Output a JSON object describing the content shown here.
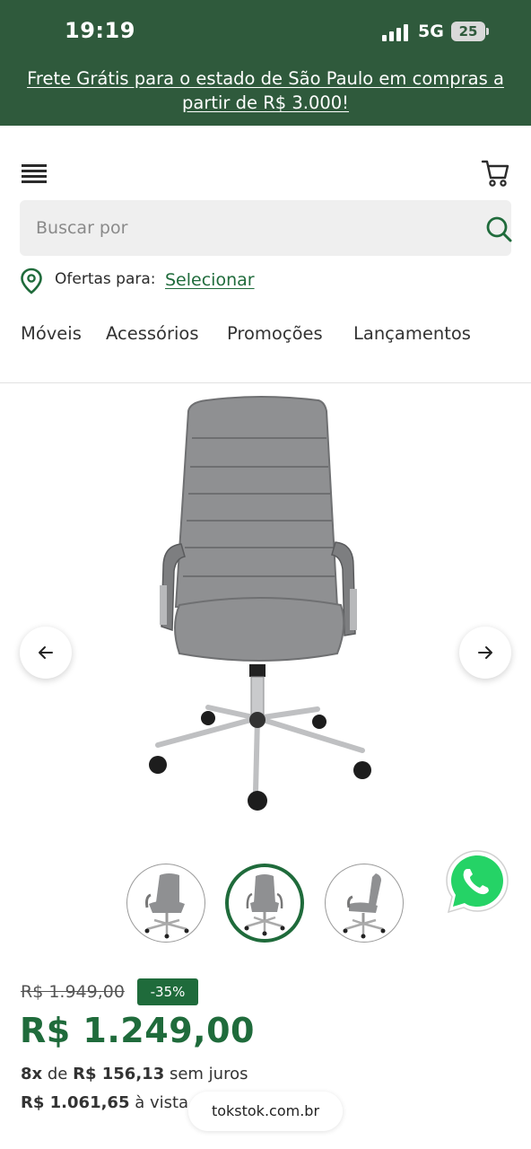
{
  "status_bar": {
    "time": "19:19",
    "network": "5G",
    "battery": "25"
  },
  "promo_banner": {
    "text": "Frete Grátis para o estado de São Paulo em compras a partir de R$ 3.000!",
    "background_color": "#2f5a3c"
  },
  "header": {
    "menu_icon": "hamburger-menu-icon",
    "cart_icon": "shopping-cart-icon"
  },
  "search": {
    "placeholder": "Buscar por",
    "icon": "search-icon"
  },
  "location": {
    "label": "Ofertas para:",
    "link": "Selecionar",
    "icon": "map-pin-icon"
  },
  "categories": [
    {
      "label": "Móveis"
    },
    {
      "label": "Acessórios"
    },
    {
      "label": "Promoções"
    },
    {
      "label": "Lançamentos"
    }
  ],
  "gallery": {
    "prev_icon": "arrow-left-icon",
    "next_icon": "arrow-right-icon",
    "thumbnails": [
      {
        "name": "chair-angled-view",
        "active": false
      },
      {
        "name": "chair-front-view",
        "active": true
      },
      {
        "name": "chair-side-view",
        "active": false
      }
    ]
  },
  "whatsapp": {
    "icon": "whatsapp-icon",
    "color": "#25d366"
  },
  "pricing": {
    "old_price": "R$ 1.949,00",
    "discount": "-35%",
    "price": "R$ 1.249,00",
    "installments_count": "8x",
    "installments_of": "de",
    "installments_value": "R$ 156,13",
    "installments_suffix": "sem juros",
    "cash_value": "R$ 1.061,65",
    "cash_suffix": "à vista"
  },
  "browser": {
    "url": "tokstok.com.br"
  },
  "theme": {
    "accent": "#1f6b3b"
  }
}
